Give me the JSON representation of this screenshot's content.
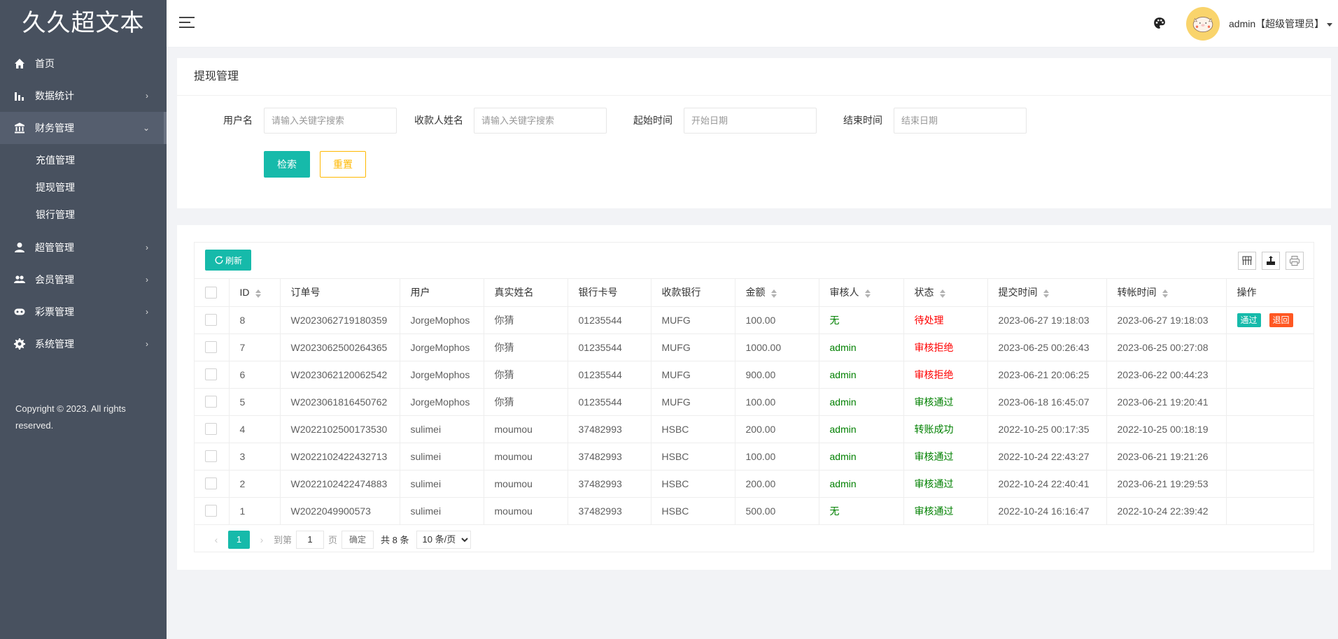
{
  "app": {
    "logo": "久久超文本"
  },
  "sidebar": {
    "items": [
      {
        "label": "首页",
        "icon": "home-icon",
        "arrow": ""
      },
      {
        "label": "数据统计",
        "icon": "bar-chart-icon",
        "arrow": "›"
      },
      {
        "label": "财务管理",
        "icon": "bank-icon",
        "arrow": "⌄",
        "active": true
      },
      {
        "label": "超管管理",
        "icon": "user-icon",
        "arrow": "›"
      },
      {
        "label": "会员管理",
        "icon": "users-icon",
        "arrow": "›"
      },
      {
        "label": "彩票管理",
        "icon": "gamepad-icon",
        "arrow": "›"
      },
      {
        "label": "系统管理",
        "icon": "gear-icon",
        "arrow": "›"
      }
    ],
    "submenu": [
      "充值管理",
      "提现管理",
      "银行管理"
    ],
    "copyright": "Copyright © 2023. All rights reserved."
  },
  "header": {
    "user": "admin【超级管理员】",
    "icons": [
      "menu-toggle-icon",
      "palette-icon",
      "avatar"
    ]
  },
  "search": {
    "title": "提现管理",
    "fields": [
      {
        "label": "用户名",
        "placeholder": "请输入关键字搜索",
        "value": ""
      },
      {
        "label": "收款人姓名",
        "placeholder": "请输入关键字搜索",
        "value": ""
      },
      {
        "label": "起始时间",
        "placeholder": "开始日期",
        "value": ""
      },
      {
        "label": "结束时间",
        "placeholder": "结束日期",
        "value": ""
      }
    ],
    "search_label": "检索",
    "reset_label": "重置"
  },
  "table": {
    "refresh_label": "刷新",
    "tool_icons": [
      "columns-icon",
      "export-icon",
      "print-icon"
    ],
    "columns": [
      "",
      "ID",
      "订单号",
      "用户",
      "真实姓名",
      "银行卡号",
      "收款银行",
      "金额",
      "审核人",
      "状态",
      "提交时间",
      "转帐时间",
      "操作"
    ],
    "sortable": [
      false,
      true,
      false,
      false,
      false,
      false,
      false,
      true,
      true,
      true,
      true,
      true,
      false
    ],
    "rows": [
      {
        "id": "8",
        "order": "W2023062719180359",
        "user": "JorgeMophos",
        "real_name": "你猜",
        "card": "01235544",
        "bank": "MUFG",
        "amount": "100.00",
        "reviewer": "无",
        "status": "待处理",
        "status_color": "red",
        "submit_time": "2023-06-27 19:18:03",
        "transfer_time": "2023-06-27 19:18:03",
        "actions": [
          "通过",
          "退回"
        ]
      },
      {
        "id": "7",
        "order": "W2023062500264365",
        "user": "JorgeMophos",
        "real_name": "你猜",
        "card": "01235544",
        "bank": "MUFG",
        "amount": "1000.00",
        "reviewer": "admin",
        "status": "审核拒绝",
        "status_color": "red",
        "submit_time": "2023-06-25 00:26:43",
        "transfer_time": "2023-06-25 00:27:08",
        "actions": []
      },
      {
        "id": "6",
        "order": "W2023062120062542",
        "user": "JorgeMophos",
        "real_name": "你猜",
        "card": "01235544",
        "bank": "MUFG",
        "amount": "900.00",
        "reviewer": "admin",
        "status": "审核拒绝",
        "status_color": "red",
        "submit_time": "2023-06-21 20:06:25",
        "transfer_time": "2023-06-22 00:44:23",
        "actions": []
      },
      {
        "id": "5",
        "order": "W2023061816450762",
        "user": "JorgeMophos",
        "real_name": "你猜",
        "card": "01235544",
        "bank": "MUFG",
        "amount": "100.00",
        "reviewer": "admin",
        "status": "审核通过",
        "status_color": "green",
        "submit_time": "2023-06-18 16:45:07",
        "transfer_time": "2023-06-21 19:20:41",
        "actions": []
      },
      {
        "id": "4",
        "order": "W2022102500173530",
        "user": "sulimei",
        "real_name": "moumou",
        "card": "37482993",
        "bank": "HSBC",
        "amount": "200.00",
        "reviewer": "admin",
        "status": "转账成功",
        "status_color": "green",
        "submit_time": "2022-10-25 00:17:35",
        "transfer_time": "2022-10-25 00:18:19",
        "actions": []
      },
      {
        "id": "3",
        "order": "W2022102422432713",
        "user": "sulimei",
        "real_name": "moumou",
        "card": "37482993",
        "bank": "HSBC",
        "amount": "100.00",
        "reviewer": "admin",
        "status": "审核通过",
        "status_color": "green",
        "submit_time": "2022-10-24 22:43:27",
        "transfer_time": "2023-06-21 19:21:26",
        "actions": []
      },
      {
        "id": "2",
        "order": "W2022102422474883",
        "user": "sulimei",
        "real_name": "moumou",
        "card": "37482993",
        "bank": "HSBC",
        "amount": "200.00",
        "reviewer": "admin",
        "status": "审核通过",
        "status_color": "green",
        "submit_time": "2022-10-24 22:40:41",
        "transfer_time": "2023-06-21 19:29:53",
        "actions": []
      },
      {
        "id": "1",
        "order": "W2022049900573",
        "user": "sulimei",
        "real_name": "moumou",
        "card": "37482993",
        "bank": "HSBC",
        "amount": "500.00",
        "reviewer": "无",
        "status": "审核通过",
        "status_color": "green",
        "submit_time": "2022-10-24 16:16:47",
        "transfer_time": "2022-10-24 22:39:42",
        "actions": []
      }
    ]
  },
  "pagination": {
    "prev": "‹",
    "current": "1",
    "next": "›",
    "goto_label": "到第",
    "goto_value": "1",
    "page_unit": "页",
    "confirm_label": "确定",
    "total": "共 8 条",
    "page_size": "10 条/页"
  },
  "colors": {
    "primary": "#16baaa",
    "warning": "#ffb800",
    "danger": "#ff5722",
    "sidebar_bg": "#48515f",
    "status_green": "#008000",
    "status_red": "#ff0000"
  }
}
